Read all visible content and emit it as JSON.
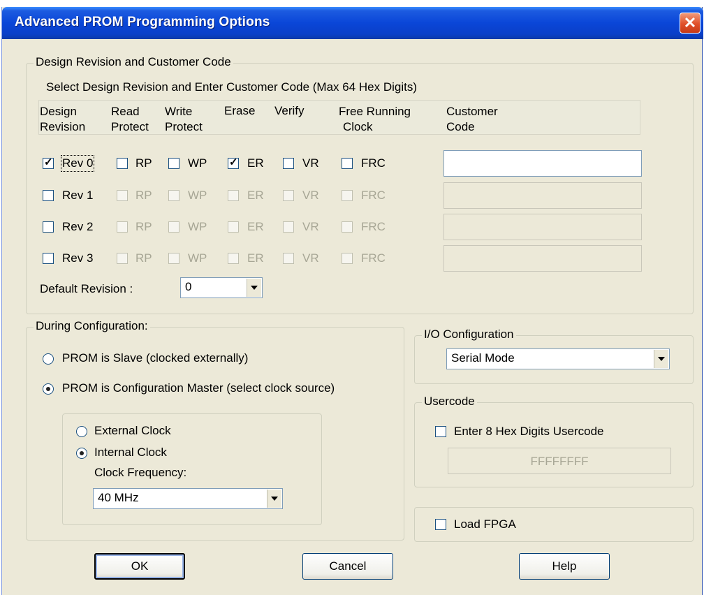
{
  "window": {
    "title": "Advanced PROM Programming Options",
    "close_label": "✕"
  },
  "design_group": {
    "legend": "Design Revision and Customer Code",
    "instruction": "Select Design Revision and Enter Customer Code (Max 64 Hex Digits)",
    "headers": {
      "design_revision": [
        "Design",
        "Revision"
      ],
      "read_protect": [
        "Read",
        "Protect"
      ],
      "write_protect": [
        "Write",
        "Protect"
      ],
      "erase": "Erase",
      "verify": "Verify",
      "free_running_clock": [
        "Free Running",
        "Clock"
      ],
      "customer_code": [
        "Customer",
        "Code"
      ]
    },
    "rows": [
      {
        "rev": "Rev 0",
        "rev_checked": true,
        "rp": "RP",
        "rp_checked": false,
        "wp": "WP",
        "wp_checked": false,
        "er": "ER",
        "er_checked": true,
        "vr": "VR",
        "vr_checked": false,
        "frc": "FRC",
        "frc_checked": false,
        "enabled": true,
        "code": ""
      },
      {
        "rev": "Rev 1",
        "rev_checked": false,
        "rp": "RP",
        "rp_checked": false,
        "wp": "WP",
        "wp_checked": false,
        "er": "ER",
        "er_checked": false,
        "vr": "VR",
        "vr_checked": false,
        "frc": "FRC",
        "frc_checked": false,
        "enabled": false,
        "code": ""
      },
      {
        "rev": "Rev 2",
        "rev_checked": false,
        "rp": "RP",
        "rp_checked": false,
        "wp": "WP",
        "wp_checked": false,
        "er": "ER",
        "er_checked": false,
        "vr": "VR",
        "vr_checked": false,
        "frc": "FRC",
        "frc_checked": false,
        "enabled": false,
        "code": ""
      },
      {
        "rev": "Rev 3",
        "rev_checked": false,
        "rp": "RP",
        "rp_checked": false,
        "wp": "WP",
        "wp_checked": false,
        "er": "ER",
        "er_checked": false,
        "vr": "VR",
        "vr_checked": false,
        "frc": "FRC",
        "frc_checked": false,
        "enabled": false,
        "code": ""
      }
    ],
    "default_revision_label": "Default Revision :",
    "default_revision_value": "0"
  },
  "config_group": {
    "legend": "During Configuration:",
    "slave_label": "PROM is Slave (clocked externally)",
    "master_label": "PROM is Configuration Master (select clock source)",
    "selected_mode": "master",
    "clock": {
      "external_label": "External Clock",
      "internal_label": "Internal Clock",
      "selected": "internal",
      "frequency_label": "Clock Frequency:",
      "frequency_value": "40 MHz"
    }
  },
  "io_group": {
    "legend": "I/O Configuration",
    "value": "Serial Mode"
  },
  "usercode_group": {
    "legend": "Usercode",
    "checkbox_label": "Enter 8 Hex Digits Usercode",
    "checked": false,
    "value": "FFFFFFFF"
  },
  "load_fpga": {
    "label": "Load FPGA",
    "checked": false
  },
  "buttons": {
    "ok": "OK",
    "cancel": "Cancel",
    "help": "Help"
  },
  "colors": {
    "titlebar": "#0a46d8",
    "dialog_bg": "#ece9d8",
    "close": "#e0502a",
    "disabled_text": "#a7a695"
  }
}
